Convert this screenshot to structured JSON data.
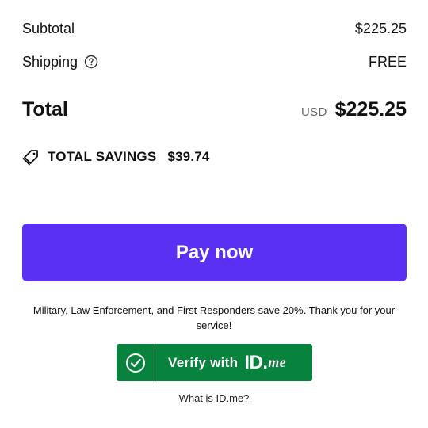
{
  "summary": {
    "subtotal_label": "Subtotal",
    "subtotal_value": "$225.25",
    "shipping_label": "Shipping",
    "shipping_value": "FREE",
    "total_label": "Total",
    "total_currency": "USD",
    "total_value": "$225.25"
  },
  "savings": {
    "label": "TOTAL SAVINGS",
    "amount": "$39.74",
    "icon": "tag-icon"
  },
  "pay_button": {
    "label": "Pay now",
    "color": "#5a31f4"
  },
  "idme": {
    "promo_text": "Military, Law Enforcement, and First Responders save 20%. Thank you for your service!",
    "button_label": "Verify with",
    "logo_id": "ID",
    "logo_dot": ".",
    "logo_me": "me",
    "link_text": "What is ID.me?",
    "color": "#08833d",
    "icon": "check-circle-icon"
  },
  "icons": {
    "shipping_help": "question-circle-icon"
  }
}
